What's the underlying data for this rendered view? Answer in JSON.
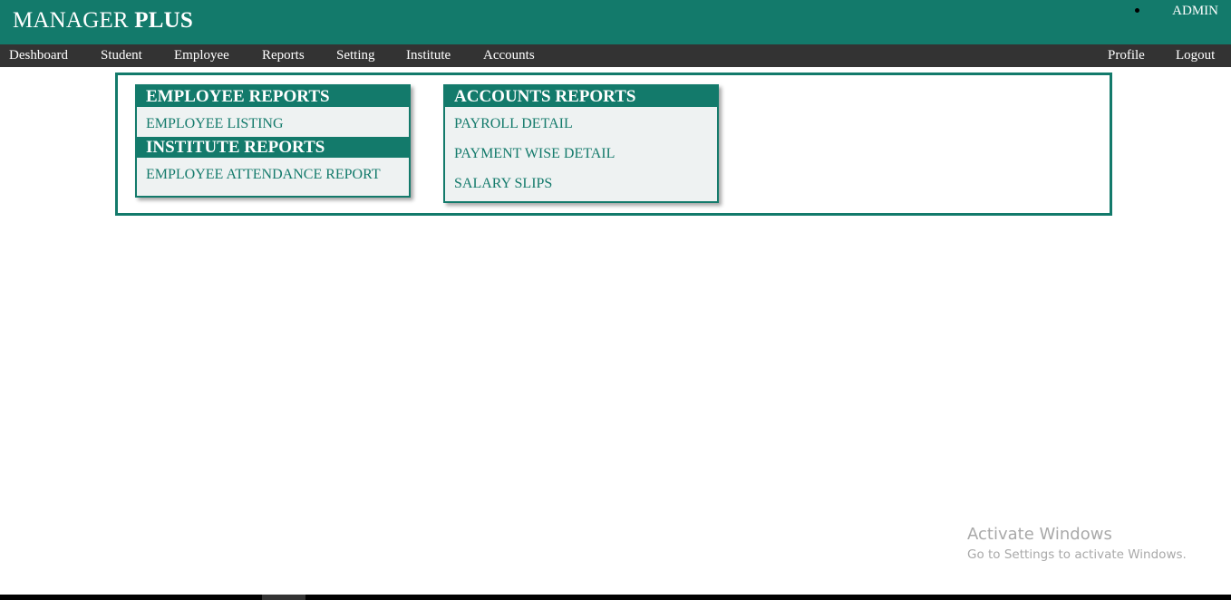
{
  "header": {
    "brand_part1": "MANAGER",
    "brand_part2": "PLUS",
    "user": "ADMIN",
    "background_color": "#137a6b"
  },
  "nav": {
    "background_color": "#333333",
    "left_items": [
      "Deshboard",
      "Student",
      "Employee",
      "Reports",
      "Setting",
      "Institute",
      "Accounts"
    ],
    "right_items": [
      "Profile",
      "Logout"
    ]
  },
  "reports": {
    "employee_reports": {
      "title": "EMPLOYEE REPORTS",
      "links": [
        "EMPLOYEE LISTING"
      ]
    },
    "institute_reports": {
      "title": "INSTITUTE REPORTS",
      "links": [
        "EMPLOYEE ATTENDANCE REPORT"
      ]
    },
    "accounts_reports": {
      "title": "ACCOUNTS REPORTS",
      "links": [
        "PAYROLL DETAIL",
        "PAYMENT WISE DETAIL",
        "SALARY SLIPS"
      ]
    }
  },
  "watermark": {
    "title": "Activate Windows",
    "subtitle": "Go to Settings to activate Windows."
  }
}
